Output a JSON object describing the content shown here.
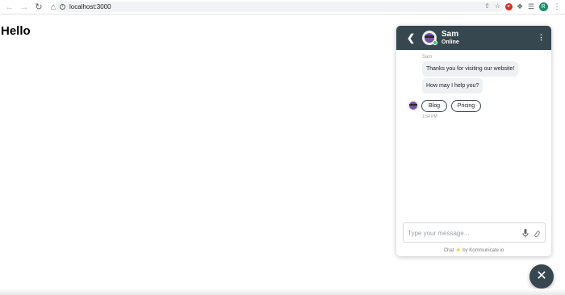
{
  "browser": {
    "url": "localhost:3000",
    "profile_initial": "R"
  },
  "page": {
    "heading": "Hello"
  },
  "chat": {
    "agent_name": "Sam",
    "agent_status": "Online",
    "sender_label": "Sam",
    "messages": [
      "Thanks you for visiting our website!",
      "How may I help you?"
    ],
    "quick_replies": [
      "Blog",
      "Pricing"
    ],
    "timestamp": "1:54 PM",
    "input_placeholder": "Type your message...",
    "powered_by_prefix": "Chat",
    "powered_by_suffix": "by Kommunicate.io",
    "colors": {
      "header": "#37474f",
      "online": "#2ecc71",
      "bubble": "#eef1f3"
    }
  },
  "icons": {
    "back": "chevron-left-icon",
    "menu": "kebab-menu-icon",
    "mic": "microphone-icon",
    "attach": "paperclip-icon",
    "close": "close-icon"
  }
}
